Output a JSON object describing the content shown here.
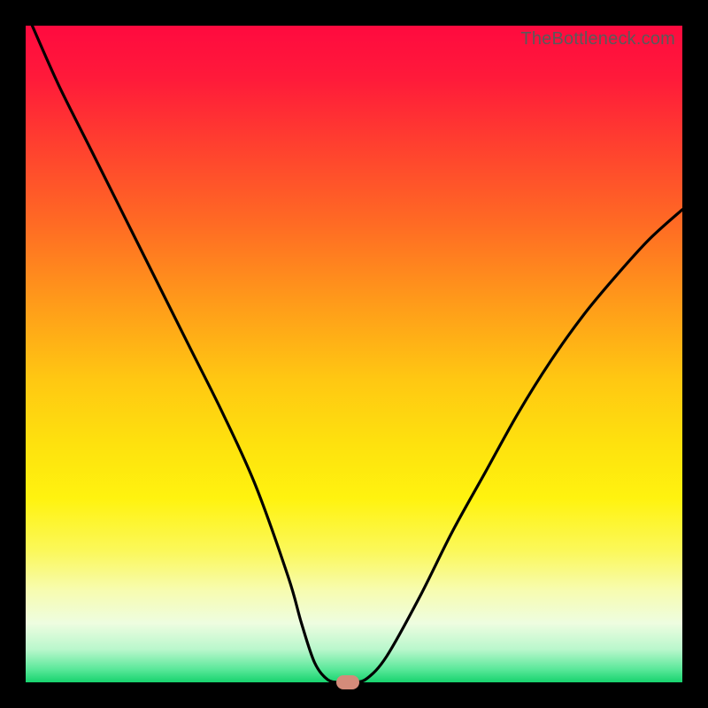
{
  "watermark": "TheBottleneck.com",
  "chart_data": {
    "type": "line",
    "title": "",
    "xlabel": "",
    "ylabel": "",
    "xlim": [
      0,
      100
    ],
    "ylim": [
      0,
      100
    ],
    "series": [
      {
        "name": "bottleneck-curve",
        "x": [
          1,
          5,
          10,
          15,
          20,
          25,
          30,
          35,
          40,
          42,
          44,
          46,
          48,
          50,
          52,
          55,
          60,
          65,
          70,
          75,
          80,
          85,
          90,
          95,
          100
        ],
        "y": [
          100,
          91,
          81,
          71,
          61,
          51,
          41,
          30,
          16,
          9,
          3,
          0.4,
          0,
          0,
          0.6,
          4,
          13,
          23,
          32,
          41,
          49,
          56,
          62,
          67.5,
          72
        ]
      }
    ],
    "marker": {
      "x": 49,
      "y": 0
    },
    "gradient_stops": [
      {
        "pos": 0,
        "color": "#ff0a3f"
      },
      {
        "pos": 50,
        "color": "#ffd400"
      },
      {
        "pos": 88,
        "color": "#feffd0"
      },
      {
        "pos": 100,
        "color": "#17d36e"
      }
    ]
  }
}
